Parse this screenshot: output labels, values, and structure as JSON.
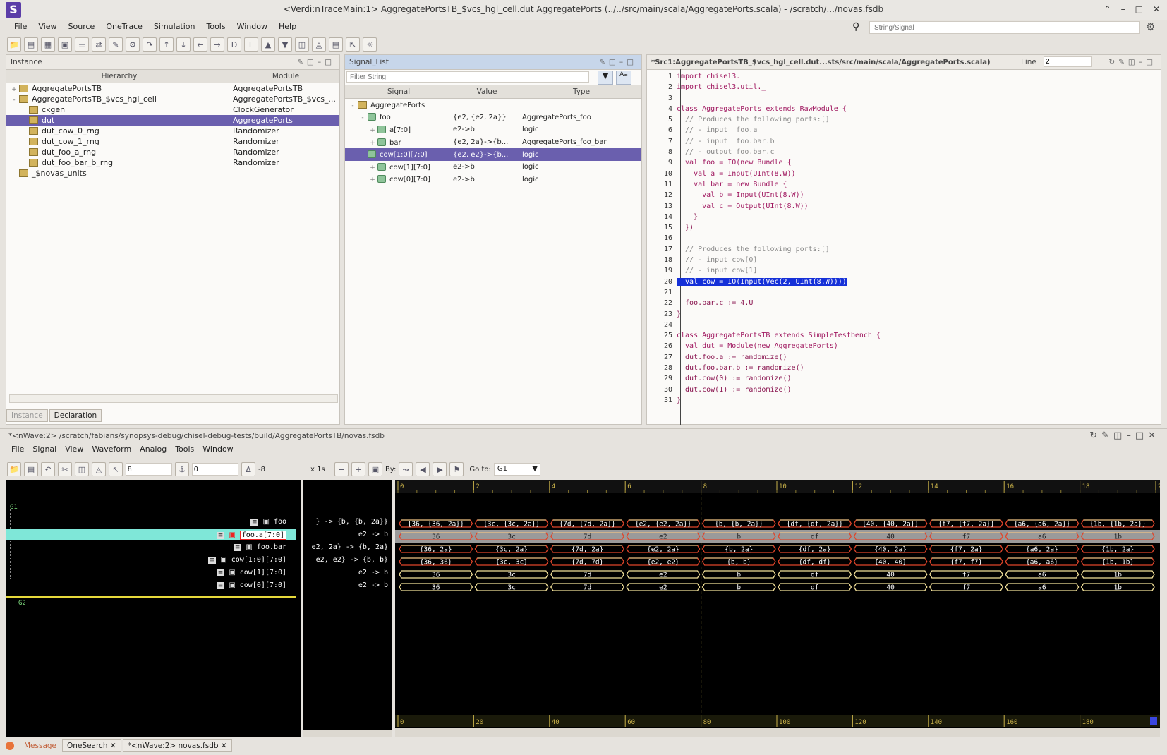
{
  "window": {
    "title": "<Verdi:nTraceMain:1> AggregatePortsTB_$vcs_hgl_cell.dut AggregatePorts (../../src/main/scala/AggregatePorts.scala) - /scratch/.../novas.fsdb",
    "logo": "S"
  },
  "menu": [
    "File",
    "View",
    "Source",
    "OneTrace",
    "Simulation",
    "Tools",
    "Window",
    "Help"
  ],
  "search": {
    "placeholder": "String/Signal"
  },
  "instance_panel": {
    "title": "Instance",
    "col_hierarchy": "Hierarchy",
    "col_module": "Module",
    "rows": [
      {
        "name": "AggregatePortsTB",
        "module": "AggregatePortsTB",
        "indent": 0,
        "fold": "+",
        "selected": false
      },
      {
        "name": "AggregatePortsTB_$vcs_hgl_cell",
        "module": "AggregatePortsTB_$vcs_...",
        "indent": 0,
        "fold": "-",
        "selected": false
      },
      {
        "name": "ckgen",
        "module": "ClockGenerator",
        "indent": 1,
        "fold": "",
        "selected": false
      },
      {
        "name": "dut",
        "module": "AggregatePorts",
        "indent": 1,
        "fold": "",
        "selected": true
      },
      {
        "name": "dut_cow_0_rng",
        "module": "Randomizer",
        "indent": 1,
        "fold": "",
        "selected": false
      },
      {
        "name": "dut_cow_1_rng",
        "module": "Randomizer",
        "indent": 1,
        "fold": "",
        "selected": false
      },
      {
        "name": "dut_foo_a_rng",
        "module": "Randomizer",
        "indent": 1,
        "fold": "",
        "selected": false
      },
      {
        "name": "dut_foo_bar_b_rng",
        "module": "Randomizer",
        "indent": 1,
        "fold": "",
        "selected": false
      },
      {
        "name": "_$novas_units",
        "module": "",
        "indent": 0,
        "fold": "",
        "selected": false
      }
    ],
    "tabs": [
      "Instance",
      "Declaration"
    ]
  },
  "signal_panel": {
    "title": "Signal_List",
    "filter_placeholder": "Filter String",
    "col_signal": "Signal",
    "col_value": "Value",
    "col_type": "Type",
    "rows": [
      {
        "name": "AggregatePorts",
        "value": "",
        "type": "",
        "indent": 0,
        "fold": "-",
        "icon": "folder",
        "selected": false
      },
      {
        "name": "foo",
        "value": "{e2, {e2, 2a}}",
        "type": "AggregatePorts_foo",
        "indent": 1,
        "fold": "-",
        "icon": "group",
        "selected": false
      },
      {
        "name": "a[7:0]",
        "value": "e2->b",
        "type": "logic",
        "indent": 2,
        "fold": "+",
        "icon": "group",
        "selected": false
      },
      {
        "name": "bar",
        "value": "{e2, 2a}->{b...",
        "type": "AggregatePorts_foo_bar",
        "indent": 2,
        "fold": "+",
        "icon": "group",
        "selected": false
      },
      {
        "name": "cow[1:0][7:0]",
        "value": "{e2, e2}->{b...",
        "type": "logic",
        "indent": 1,
        "fold": "-",
        "icon": "group",
        "selected": true
      },
      {
        "name": "cow[1][7:0]",
        "value": "e2->b",
        "type": "logic",
        "indent": 2,
        "fold": "+",
        "icon": "group",
        "selected": false
      },
      {
        "name": "cow[0][7:0]",
        "value": "e2->b",
        "type": "logic",
        "indent": 2,
        "fold": "+",
        "icon": "group",
        "selected": false
      }
    ]
  },
  "source_panel": {
    "title": "*Src1:AggregatePortsTB_$vcs_hgl_cell.dut...sts/src/main/scala/AggregatePorts.scala)",
    "line_label": "Line",
    "line_value": "2",
    "lines": [
      "import chisel3._",
      "import chisel3.util._",
      "",
      "class AggregatePorts extends RawModule {",
      "  // Produces the following ports:[]",
      "  // - input  foo.a",
      "  // - input  foo.bar.b",
      "  // - output foo.bar.c",
      "  val foo = IO(new Bundle {",
      "    val a = Input(UInt(8.W))",
      "    val bar = new Bundle {",
      "      val b = Input(UInt(8.W))",
      "      val c = Output(UInt(8.W))",
      "    }",
      "  })",
      "",
      "  // Produces the following ports:[]",
      "  // - input cow[0]",
      "  // - input cow[1]",
      "  val cow = IO(Input(Vec(2, UInt(8.W))))",
      "",
      "  foo.bar.c := 4.U",
      "}",
      "",
      "class AggregatePortsTB extends SimpleTestbench {",
      "  val dut = Module(new AggregatePorts)",
      "  dut.foo.a := randomize()",
      "  dut.foo.bar.b := randomize()",
      "  dut.cow(0) := randomize()",
      "  dut.cow(1) := randomize()",
      "}"
    ],
    "highlight_line": 20
  },
  "wave_window": {
    "title": "*<nWave:2> /scratch/fabians/synopsys-debug/chisel-debug-tests/build/AggregatePortsTB/novas.fsdb",
    "menu": [
      "File",
      "Signal",
      "View",
      "Waveform",
      "Analog",
      "Tools",
      "Window"
    ],
    "cursor_value": "8",
    "marker_value": "0",
    "delta_value": "-8",
    "scale": "x 1s",
    "by_label": "By:",
    "goto_label": "Go to:",
    "goto_value": "G1",
    "groups": [
      "G1",
      "G2"
    ],
    "signals": [
      {
        "name": "foo",
        "value": "} -> {b, {b, 2a}}",
        "selected": false
      },
      {
        "name": "foo.a[7:0]",
        "value": "e2 -> b",
        "selected": true
      },
      {
        "name": "foo.bar",
        "value": "e2, 2a} -> {b, 2a}",
        "selected": false
      },
      {
        "name": "cow[1:0][7:0]",
        "value": "e2, e2} -> {b, b}",
        "selected": false
      },
      {
        "name": "cow[1][7:0]",
        "value": "e2 -> b",
        "selected": false
      },
      {
        "name": "cow[0][7:0]",
        "value": "e2 -> b",
        "selected": false
      }
    ],
    "time_ticks": [
      "0",
      "2",
      "4",
      "6",
      "8",
      "10",
      "12",
      "14",
      "16",
      "18",
      "20"
    ],
    "bottom_ticks": [
      "0",
      "20",
      "40",
      "60",
      "80",
      "100",
      "120",
      "140",
      "160",
      "180"
    ],
    "cursor_time": 8,
    "segments": [
      [
        "{36, {36, 2a}}",
        "{3c, {3c, 2a}}",
        "{7d, {7d, 2a}}",
        "{e2, {e2, 2a}}",
        "{b, {b, 2a}}",
        "{df, {df, 2a}}",
        "{40, {40, 2a}}",
        "{f7, {f7, 2a}}",
        "{a6, {a6, 2a}}",
        "{1b, {1b, 2a}}"
      ],
      [
        "36",
        "3c",
        "7d",
        "e2",
        "b",
        "df",
        "40",
        "f7",
        "a6",
        "1b"
      ],
      [
        "{36, 2a}",
        "{3c, 2a}",
        "{7d, 2a}",
        "{e2, 2a}",
        "{b, 2a}",
        "{df, 2a}",
        "{40, 2a}",
        "{f7, 2a}",
        "{a6, 2a}",
        "{1b, 2a}"
      ],
      [
        "{36, 36}",
        "{3c, 3c}",
        "{7d, 7d}",
        "{e2, e2}",
        "{b, b}",
        "{df, df}",
        "{40, 40}",
        "{f7, f7}",
        "{a6, a6}",
        "{1b, 1b}"
      ],
      [
        "36",
        "3c",
        "7d",
        "e2",
        "b",
        "df",
        "40",
        "f7",
        "a6",
        "1b"
      ],
      [
        "36",
        "3c",
        "7d",
        "e2",
        "b",
        "df",
        "40",
        "f7",
        "a6",
        "1b"
      ]
    ],
    "colors": {
      "bus": "#f4e29a",
      "bus_red": "#e0452a",
      "selected_row": "#7fe7d8",
      "cursor": "#d8c24a"
    }
  },
  "bottom_tabs": [
    "Message",
    "OneSearch",
    "*<nWave:2> novas.fsdb"
  ]
}
